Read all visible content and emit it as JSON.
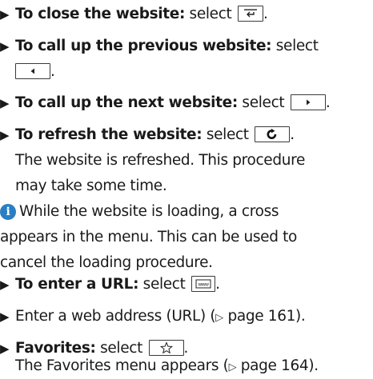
{
  "items": [
    {
      "bold": "To close the website:",
      "rest": " select"
    },
    {
      "bold": "To call up the previous website:",
      "rest": " select"
    },
    {
      "bold": "To call up the next website:",
      "rest": " select"
    },
    {
      "bold": "To refresh the website:",
      "rest": " select",
      "cont1": "The website is refreshed. This procedure",
      "cont2": "may take some time."
    },
    {
      "line1": "While the website is loading, a cross",
      "line2": "appears in the menu. This can be used to",
      "line3": "cancel the loading procedure."
    },
    {
      "bold": "To enter a URL:",
      "rest": " select"
    },
    {
      "text": "Enter a web address (URL) (",
      "page": "page 161",
      "end": ")."
    },
    {
      "bold": "Favorites:",
      "rest": " select",
      "cont_a": "The Favorites menu appears (",
      "page": "page 164",
      "end": ")."
    }
  ],
  "symbols": {
    "bullet": "▶",
    "period": ".",
    "page_ref_arrow": "▷",
    "info": "i"
  },
  "icons": {
    "close": "back-exit-icon",
    "previous": "triangle-left-icon",
    "next": "triangle-right-icon",
    "refresh": "refresh-icon",
    "url": "www-icon",
    "favorites": "star-icon",
    "info": "info-icon"
  },
  "colors": {
    "text": "#1a1a1a",
    "info_icon": "#2a7fc4",
    "button_border": "#3a3a3a"
  }
}
